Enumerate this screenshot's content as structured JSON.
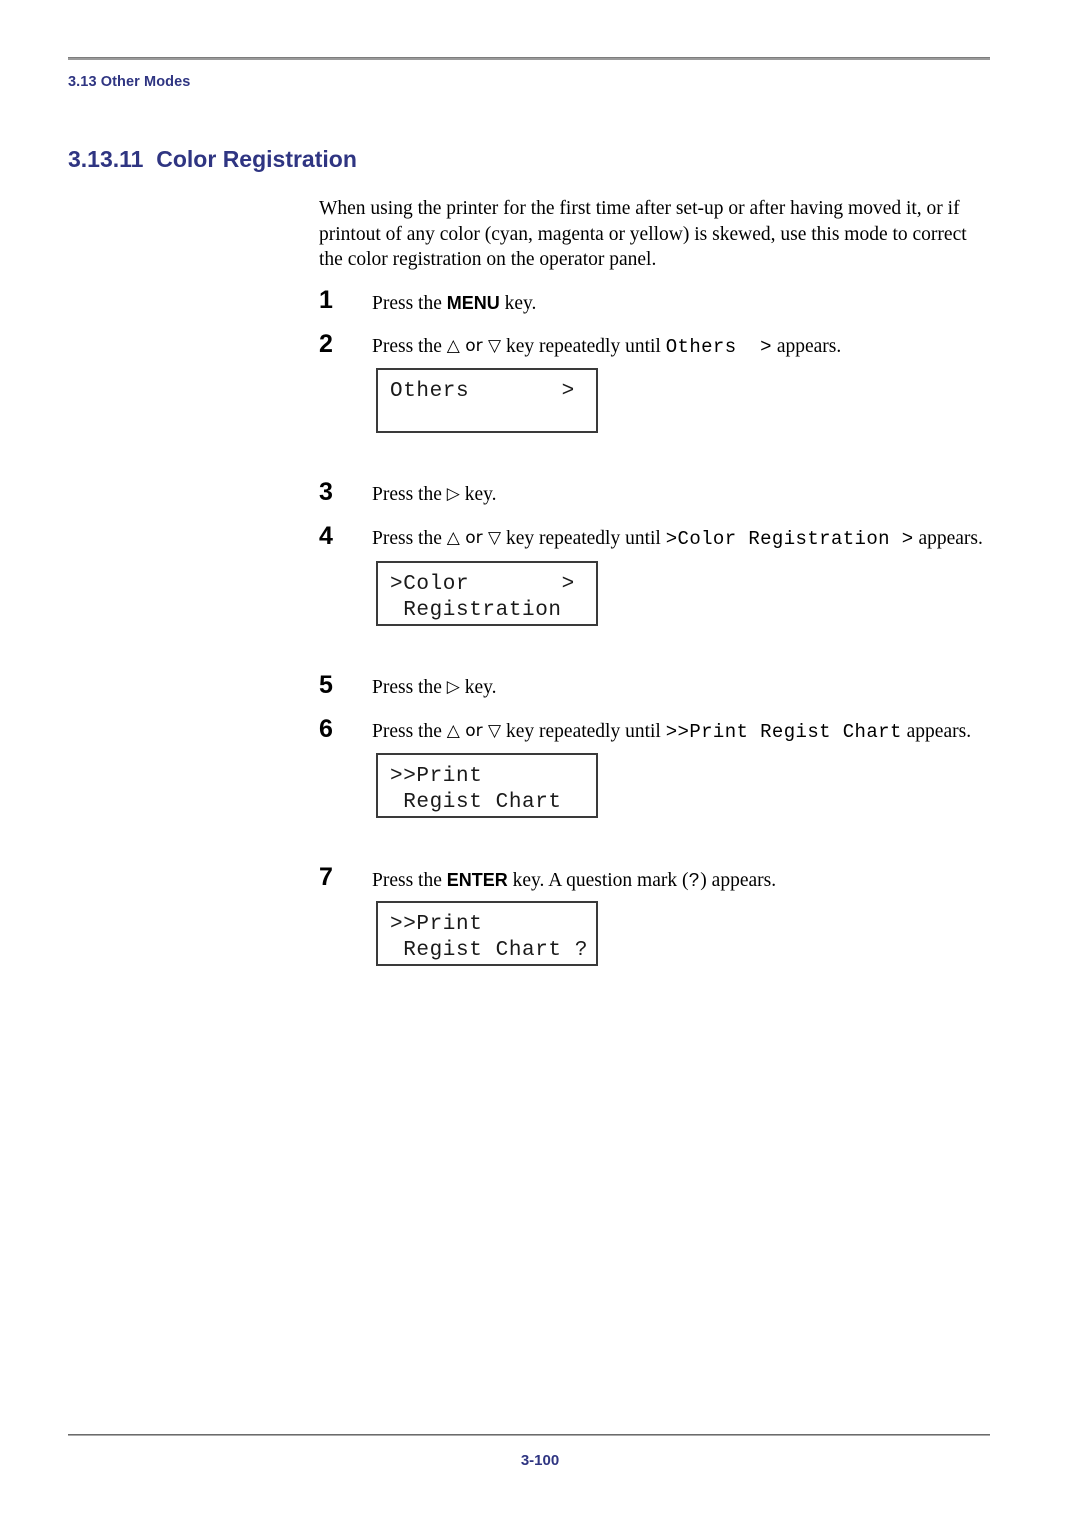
{
  "header": {
    "running_head": "3.13 Other Modes"
  },
  "section": {
    "number": "3.13.11",
    "title": "Color Registration",
    "heading_full": "3.13.11  Color Registration"
  },
  "intro": {
    "paragraph": "When using the printer for the first time after set-up or after having moved it, or if printout of any color (cyan, magenta or yellow) is skewed, use this mode to correct the color registration on the operator panel."
  },
  "steps": [
    {
      "number": "1",
      "prefix": "Press the ",
      "key": "MENU",
      "suffix": " key.",
      "mono": "",
      "tail": ""
    },
    {
      "number": "2",
      "prefix": "Press the ",
      "key": "",
      "arrows": "△ or ▽",
      "mid": " key repeatedly until ",
      "mono": "Others  >",
      "tail": " appears."
    },
    {
      "number": "3",
      "prefix": "Press the ",
      "arrows": "▷",
      "mid": " key.",
      "mono": "",
      "tail": ""
    },
    {
      "number": "4",
      "prefix": "Press the ",
      "arrows": "△ or ▽",
      "mid": " key repeatedly until ",
      "mono": ">Color Registration >",
      "tail": " appears."
    },
    {
      "number": "5",
      "prefix": "Press the ",
      "arrows": "▷",
      "mid": " key.",
      "mono": "",
      "tail": ""
    },
    {
      "number": "6",
      "prefix": "Press the ",
      "arrows": "△ or ▽",
      "mid": " key repeatedly until ",
      "mono": ">>Print Regist Chart",
      "tail": " appears."
    },
    {
      "number": "7",
      "prefix": "Press the ",
      "key": "ENTER",
      "mid": " key. A question mark (",
      "mono": "?",
      "tail": ") appears."
    }
  ],
  "lcd_panels": [
    {
      "id": "others",
      "line1": "Others       >",
      "line2": ""
    },
    {
      "id": "color-registration",
      "line1": ">Color       >",
      "line2": " Registration"
    },
    {
      "id": "print-regist-chart",
      "line1": ">>Print",
      "line2": " Regist Chart"
    },
    {
      "id": "print-regist-chart-confirm",
      "line1": ">>Print",
      "line2": " Regist Chart ?"
    }
  ],
  "footer": {
    "page_number": "3-100"
  },
  "colors": {
    "heading_blue": "#2f3582",
    "rule_gray": "#9a9a9a",
    "lcd_border": "#3a3a3a",
    "body_text": "#000000"
  }
}
